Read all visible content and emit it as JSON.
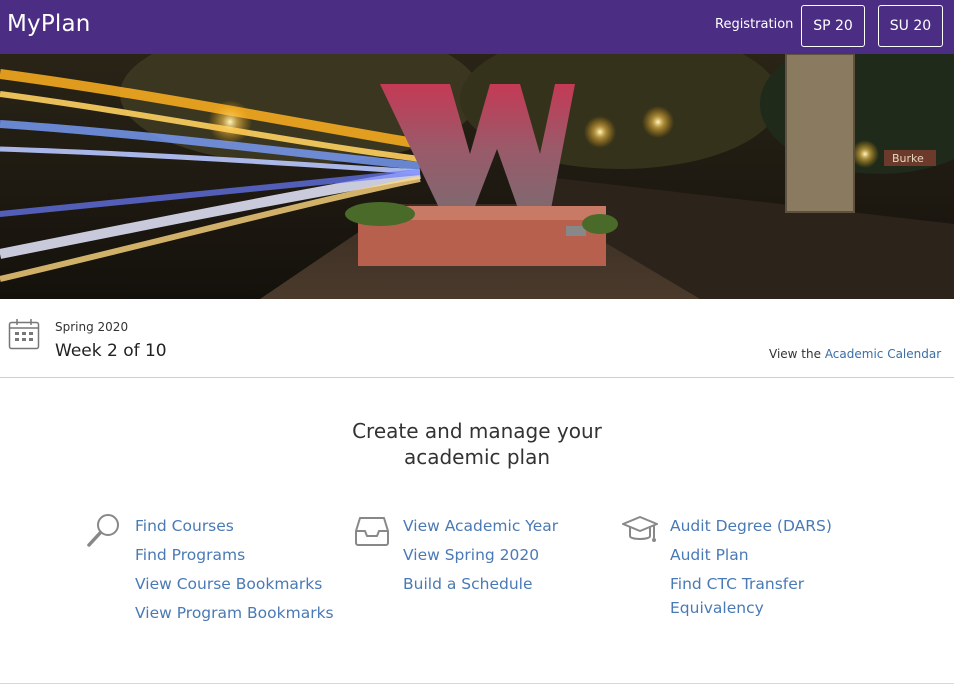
{
  "header": {
    "brand": "MyPlan",
    "registration_label": "Registration",
    "quarters": [
      "SP 20",
      "SU 20"
    ],
    "bg_color": "#4b2e83"
  },
  "term": {
    "name": "Spring 2020",
    "week": "Week 2 of 10",
    "calendar_prefix": "View the",
    "calendar_link": "Academic Calendar"
  },
  "main": {
    "headline_line1": "Create and manage your",
    "headline_line2": "academic plan",
    "columns": [
      {
        "icon": "search-icon",
        "links": [
          "Find Courses",
          "Find Programs",
          "View Course Bookmarks",
          "View Program Bookmarks"
        ]
      },
      {
        "icon": "inbox-tray-icon",
        "links": [
          "View Academic Year",
          "View Spring 2020",
          "Build a Schedule"
        ]
      },
      {
        "icon": "graduation-cap-icon",
        "links": [
          "Audit Degree (DARS)",
          "Audit Plan",
          "Find CTC Transfer",
          "Equivalency"
        ]
      }
    ]
  },
  "colors": {
    "link": "#4a7ab5",
    "brand_purple": "#4b2e83"
  }
}
